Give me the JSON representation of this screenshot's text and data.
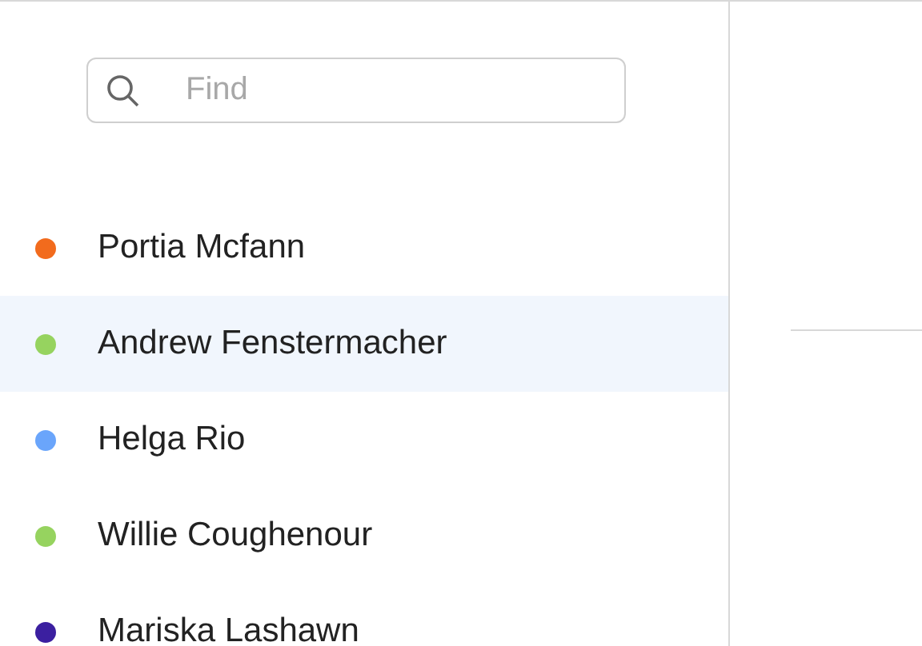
{
  "search": {
    "placeholder": "Find"
  },
  "contacts": [
    {
      "name": "Portia Mcfann",
      "color": "#f26b1d",
      "selected": false
    },
    {
      "name": "Andrew Fenstermacher",
      "color": "#96d35f",
      "selected": true
    },
    {
      "name": "Helga Rio",
      "color": "#6aa5fb",
      "selected": false
    },
    {
      "name": "Willie Coughenour",
      "color": "#96d35f",
      "selected": false
    },
    {
      "name": "Mariska Lashawn",
      "color": "#3b1fa0",
      "selected": false
    }
  ]
}
